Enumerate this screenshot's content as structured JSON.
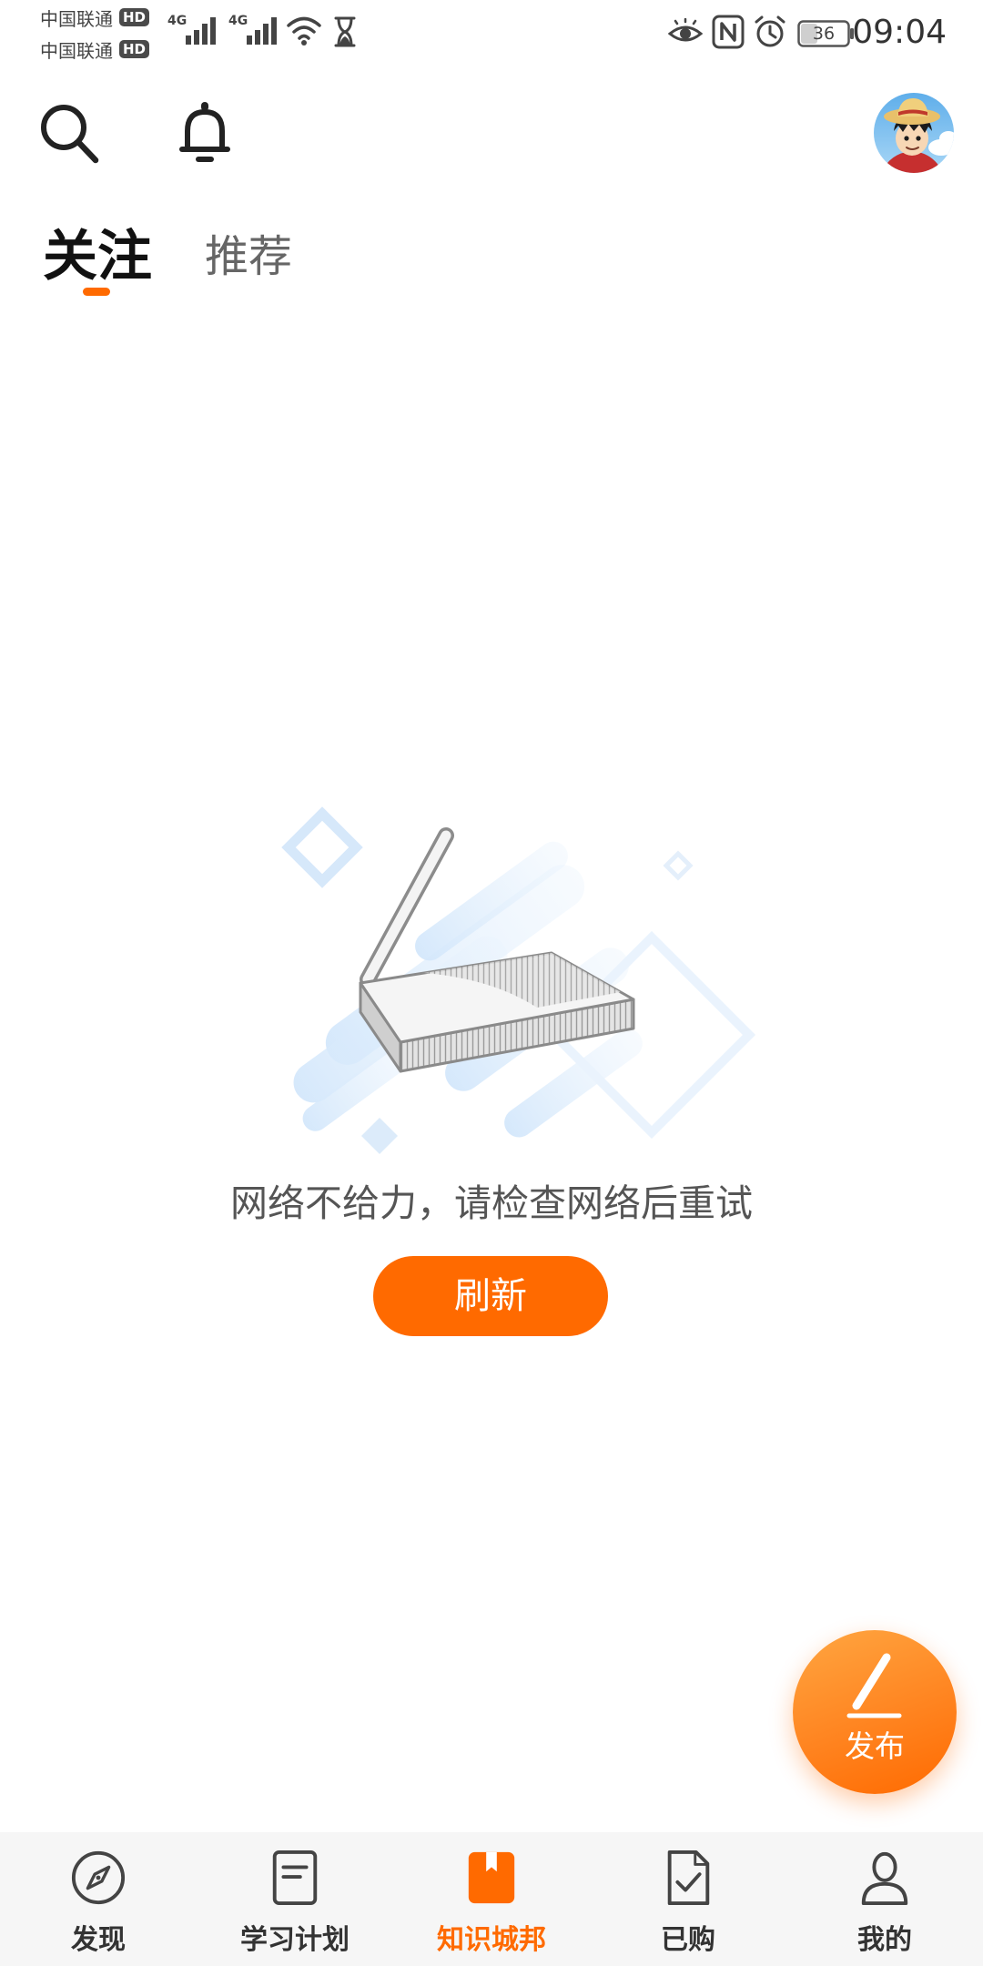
{
  "status_bar": {
    "carriers": [
      {
        "name": "中国联通",
        "badge": "HD"
      },
      {
        "name": "中国联通",
        "badge": "HD"
      }
    ],
    "network_1": "4G",
    "network_2": "4G",
    "icons_left": [
      "signal-icon",
      "signal-icon",
      "wifi-icon",
      "hourglass-icon"
    ],
    "icons_right": [
      "eye-icon",
      "nfc-icon",
      "alarm-icon",
      "battery-icon"
    ],
    "battery_level": "36",
    "time": "09:04"
  },
  "header": {
    "search_icon": "search-icon",
    "notification_icon": "bell-icon"
  },
  "tabs": [
    {
      "label": "关注",
      "active": true
    },
    {
      "label": "推荐",
      "active": false
    }
  ],
  "empty_state": {
    "illustration_icon": "router-icon",
    "message": "网络不给力，请检查网络后重试",
    "refresh_label": "刷新"
  },
  "fab": {
    "icon": "pen-icon",
    "label": "发布"
  },
  "bottom_nav": {
    "items": [
      {
        "label": "发现",
        "icon": "compass-icon",
        "active": false
      },
      {
        "label": "学习计划",
        "icon": "document-icon",
        "active": false
      },
      {
        "label": "知识城邦",
        "icon": "bookmark-icon",
        "active": true
      },
      {
        "label": "已购",
        "icon": "purchased-check-icon",
        "active": false
      },
      {
        "label": "我的",
        "icon": "person-icon",
        "active": false
      }
    ]
  },
  "colors": {
    "accent": "#FF6A00",
    "text_primary": "#111111",
    "text_secondary": "#666666",
    "nav_background": "#F6F6F6"
  }
}
